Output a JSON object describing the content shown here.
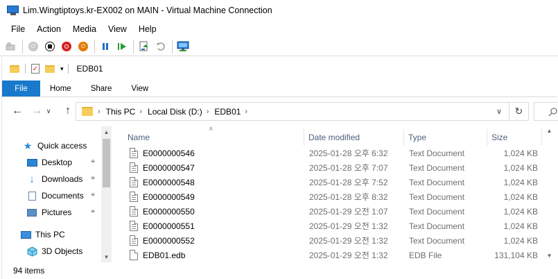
{
  "window": {
    "title": "Lim.Wingtiptoys.kr-EX002 on MAIN - Virtual Machine Connection"
  },
  "menu": [
    "File",
    "Action",
    "Media",
    "View",
    "Help"
  ],
  "vm_toolbar": {
    "buttons": [
      {
        "name": "ctrl-alt-del-icon"
      },
      {
        "name": "start-icon"
      },
      {
        "name": "turn-off-icon",
        "color": "#1a1a1a"
      },
      {
        "name": "shut-down-icon",
        "color": "#d32222"
      },
      {
        "name": "power-icon",
        "color": "#e07b00"
      },
      {
        "name": "pause-icon"
      },
      {
        "name": "resume-icon"
      },
      {
        "name": "checkpoint-icon"
      },
      {
        "name": "revert-icon"
      },
      {
        "name": "enhanced-session-icon"
      }
    ]
  },
  "quick_access_toolbar": {
    "title": "EDB01"
  },
  "ribbon": {
    "tabs": [
      "File",
      "Home",
      "Share",
      "View"
    ],
    "file_color": "#1979ca"
  },
  "address": {
    "crumbs": [
      "This PC",
      "Local Disk (D:)",
      "EDB01"
    ]
  },
  "navigation": {
    "items": [
      {
        "label": "Quick access",
        "icon": "star-icon",
        "pinned": false
      },
      {
        "label": "Desktop",
        "icon": "desktop-icon",
        "pinned": true
      },
      {
        "label": "Downloads",
        "icon": "download-icon",
        "pinned": true
      },
      {
        "label": "Documents",
        "icon": "documents-icon",
        "pinned": true
      },
      {
        "label": "Pictures",
        "icon": "pictures-icon",
        "pinned": true
      },
      {
        "label": "This PC",
        "icon": "computer-icon",
        "pinned": false
      },
      {
        "label": "3D Objects",
        "icon": "cube-icon",
        "pinned": false
      }
    ]
  },
  "files": {
    "columns": [
      "Name",
      "Date modified",
      "Type",
      "Size"
    ],
    "rows": [
      {
        "name": "E0000000546",
        "date": "2025-01-28 오후 6:32",
        "type": "Text Document",
        "size": "1,024 KB"
      },
      {
        "name": "E0000000547",
        "date": "2025-01-28 오후 7:07",
        "type": "Text Document",
        "size": "1,024 KB"
      },
      {
        "name": "E0000000548",
        "date": "2025-01-28 오후 7:52",
        "type": "Text Document",
        "size": "1,024 KB"
      },
      {
        "name": "E0000000549",
        "date": "2025-01-28 오후 8:32",
        "type": "Text Document",
        "size": "1,024 KB"
      },
      {
        "name": "E0000000550",
        "date": "2025-01-29 오전 1:07",
        "type": "Text Document",
        "size": "1,024 KB"
      },
      {
        "name": "E0000000551",
        "date": "2025-01-29 오전 1:32",
        "type": "Text Document",
        "size": "1,024 KB"
      },
      {
        "name": "E0000000552",
        "date": "2025-01-29 오전 1:32",
        "type": "Text Document",
        "size": "1,024 KB"
      },
      {
        "name": "EDB01.edb",
        "date": "2025-01-29 오전 1:32",
        "type": "EDB File",
        "size": "131,104 KB"
      }
    ]
  },
  "status": {
    "item_count": "94 items"
  }
}
